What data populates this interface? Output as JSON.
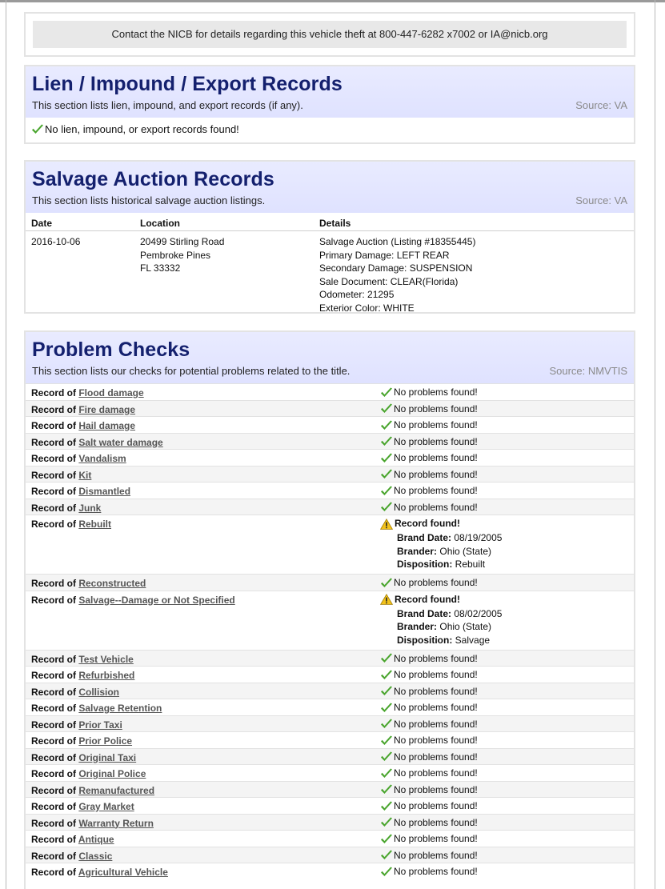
{
  "notice": "Contact the NICB for details regarding this vehicle theft at 800-447-6282 x7002 or IA@nicb.org",
  "lien": {
    "title": "Lien / Impound / Export Records",
    "description": "This section lists lien, impound, and export records (if any).",
    "source": "Source: VA",
    "message": "No lien, impound, or export records found!"
  },
  "salvage": {
    "title": "Salvage Auction Records",
    "description": "This section lists historical salvage auction listings.",
    "source": "Source: VA",
    "headers": {
      "date": "Date",
      "location": "Location",
      "details": "Details"
    },
    "row": {
      "date": "2016-10-06",
      "location": [
        "20499 Stirling Road",
        "Pembroke Pines",
        "FL 33332"
      ],
      "details": [
        "Salvage Auction (Listing #18355445)",
        "Primary Damage: LEFT REAR",
        "Secondary Damage: SUSPENSION",
        "Sale Document: CLEAR(Florida)",
        "Odometer: 21295",
        "Exterior Color: WHITE"
      ]
    }
  },
  "problems": {
    "title": "Problem Checks",
    "description": "This section lists our checks for potential problems related to the title.",
    "source": "Source: NMVTIS",
    "record_prefix": "Record of ",
    "ok_text": "No problems found!",
    "found_text": "Record found!",
    "labels": {
      "brand_date": "Brand Date:",
      "brander": "Brander:",
      "disposition": "Disposition:"
    },
    "items": [
      {
        "name": "Flood damage"
      },
      {
        "name": "Fire damage"
      },
      {
        "name": "Hail damage"
      },
      {
        "name": "Salt water damage"
      },
      {
        "name": "Vandalism"
      },
      {
        "name": "Kit"
      },
      {
        "name": "Dismantled"
      },
      {
        "name": "Junk"
      },
      {
        "name": "Rebuilt",
        "found": {
          "brand_date": "08/19/2005",
          "brander": "Ohio (State)",
          "disposition": "Rebuilt"
        }
      },
      {
        "name": "Reconstructed"
      },
      {
        "name": "Salvage--Damage or Not Specified",
        "found": {
          "brand_date": "08/02/2005",
          "brander": "Ohio (State)",
          "disposition": "Salvage"
        }
      },
      {
        "name": "Test Vehicle"
      },
      {
        "name": "Refurbished"
      },
      {
        "name": "Collision"
      },
      {
        "name": "Salvage Retention"
      },
      {
        "name": "Prior Taxi"
      },
      {
        "name": "Prior Police"
      },
      {
        "name": "Original Taxi"
      },
      {
        "name": "Original Police"
      },
      {
        "name": "Remanufactured"
      },
      {
        "name": "Gray Market"
      },
      {
        "name": "Warranty Return"
      },
      {
        "name": "Antique"
      },
      {
        "name": "Classic"
      },
      {
        "name": "Agricultural Vehicle"
      }
    ]
  }
}
